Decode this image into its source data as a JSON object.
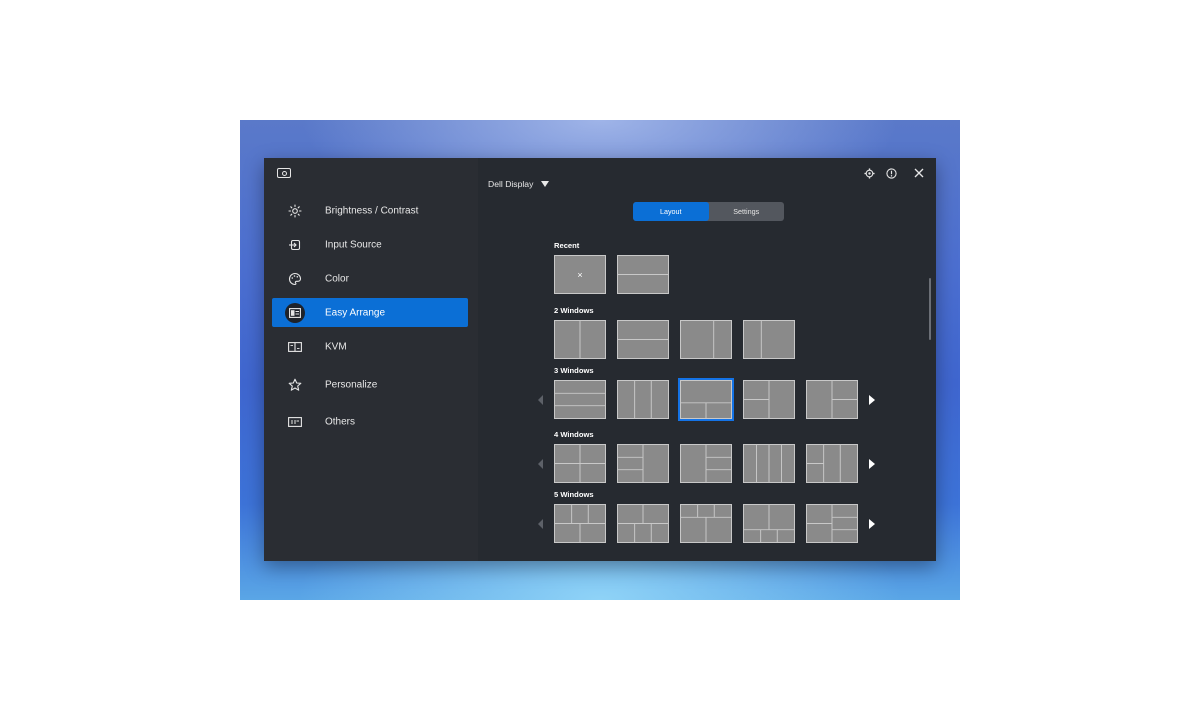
{
  "colors": {
    "accent": "#0b6fd6",
    "window_bg": "#262a30",
    "sidebar_bg": "#2a2d33",
    "thumb_fill": "#8a8a8a",
    "thumb_line": "#c8c8c8"
  },
  "app": {
    "logo_icon": "monitor-icon",
    "title": "Dell Display",
    "settings_icon": "gear-icon",
    "help_icon": "info-icon",
    "close_icon": "close-icon"
  },
  "sidebar": {
    "items": [
      {
        "label": "Brightness / Contrast",
        "icon": "sun-icon",
        "active": false
      },
      {
        "label": "Input Source",
        "icon": "input-icon",
        "active": false
      },
      {
        "label": "Color",
        "icon": "palette-icon",
        "active": false
      },
      {
        "label": "Easy Arrange",
        "icon": "easy-arrange-icon",
        "active": true
      },
      {
        "label": "KVM",
        "icon": "kvm-icon",
        "active": false
      },
      {
        "label": "Personalize",
        "icon": "star-icon",
        "active": false
      },
      {
        "label": "Others",
        "icon": "others-icon",
        "active": false
      }
    ]
  },
  "tabs": {
    "layout": "Layout",
    "settings": "Settings",
    "active": "Layout"
  },
  "sections": {
    "recent": "Recent",
    "two": "2 Windows",
    "three": "3 Windows",
    "four": "4 Windows",
    "five": "5 Windows"
  },
  "recent_clear_glyph": "×",
  "selected_layout": "3 Windows, layout 3"
}
